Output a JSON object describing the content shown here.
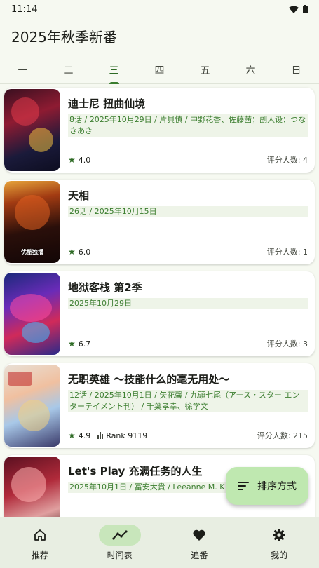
{
  "status_bar": {
    "time": "11:14",
    "wifi_icon": "wifi-icon",
    "battery_icon": "battery-icon"
  },
  "app_bar": {
    "title": "2025年秋季新番"
  },
  "tabs": [
    {
      "label": "一",
      "active": false
    },
    {
      "label": "二",
      "active": false
    },
    {
      "label": "三",
      "active": true
    },
    {
      "label": "四",
      "active": false
    },
    {
      "label": "五",
      "active": false
    },
    {
      "label": "六",
      "active": false
    },
    {
      "label": "日",
      "active": false
    }
  ],
  "anime": [
    {
      "title": "迪士尼 扭曲仙境",
      "meta": "8话 / 2025年10月29日 / 片貝慎 / 中野花香、佐藤茜；副人设：つなきあき",
      "score": "4.0",
      "rank": "",
      "raters": "评分人数: 4",
      "cover_text": ""
    },
    {
      "title": "天相",
      "meta": "26话 / 2025年10月15日",
      "score": "6.0",
      "rank": "",
      "raters": "评分人数: 1",
      "cover_text": "优酷独播"
    },
    {
      "title": "地狱客栈 第2季",
      "meta": "2025年10月29日",
      "score": "6.7",
      "rank": "",
      "raters": "评分人数: 3",
      "cover_text": ""
    },
    {
      "title": "无职英雄 〜技能什么的毫无用处〜",
      "meta": "12话 / 2025年10月1日 / 矢花馨 / 九頭七尾（アース・スター エンターテイメント刊） / 千葉孝幸、徐学文",
      "score": "4.9",
      "rank": "Rank 9119",
      "raters": "评分人数: 215",
      "cover_text": ""
    },
    {
      "title": "Let's Play 充满任务的人生",
      "meta": "2025年10月1日 / 冨安大貴 / Leeanne M. K 老沢咲希",
      "score": "",
      "rank": "",
      "raters": "",
      "cover_text": ""
    }
  ],
  "fab": {
    "label": "排序方式",
    "icon": "sort-icon"
  },
  "bottom_nav": [
    {
      "label": "推荐",
      "icon": "home-icon",
      "active": false
    },
    {
      "label": "时间表",
      "icon": "timeline-icon",
      "active": true
    },
    {
      "label": "追番",
      "icon": "heart-icon",
      "active": false
    },
    {
      "label": "我的",
      "icon": "gear-icon",
      "active": false
    }
  ],
  "colors": {
    "accent": "#3a7d2e",
    "background": "#f6f9f1",
    "fab": "#bfe8b0",
    "nav_active": "#c8e6bb"
  }
}
